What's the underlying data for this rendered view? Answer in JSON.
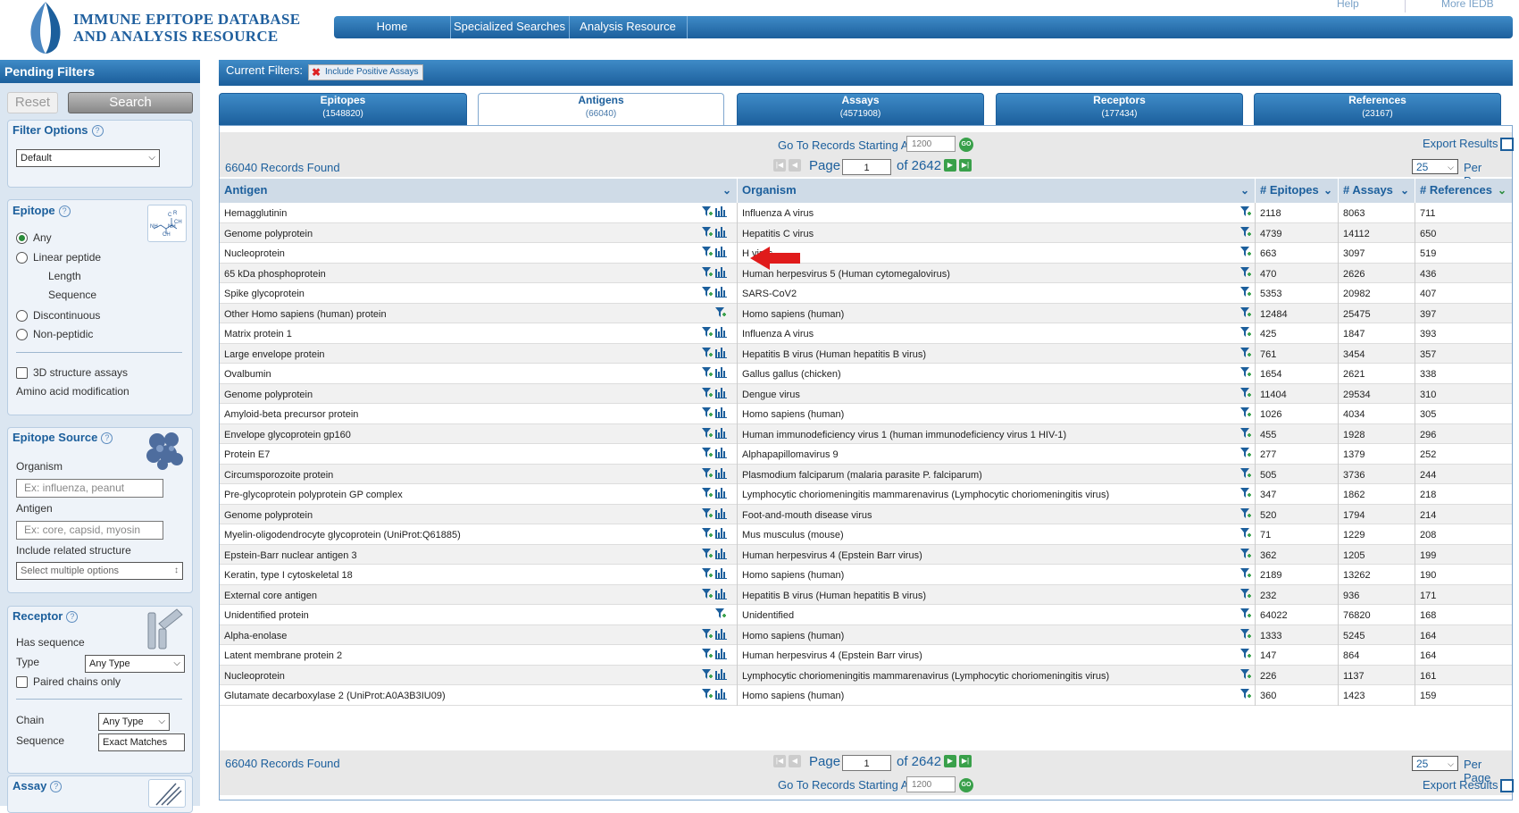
{
  "header": {
    "logo_line1": "IMMUNE EPITOPE DATABASE",
    "logo_line2": "AND ANALYSIS RESOURCE",
    "help": "Help",
    "more": "More IEDB",
    "nav": [
      "Home",
      "Specialized Searches",
      "Analysis Resource"
    ]
  },
  "left_panel": {
    "title": "Pending Filters",
    "reset": "Reset",
    "search": "Search",
    "filter_options": {
      "title": "Filter Options",
      "select": "Default"
    },
    "epitope": {
      "title": "Epitope",
      "any": "Any",
      "linear": "Linear peptide",
      "length": "Length",
      "sequence": "Sequence",
      "discontinuous": "Discontinuous",
      "non_peptidic": "Non-peptidic",
      "structure": "3D structure assays",
      "amino": "Amino acid modification"
    },
    "epitope_source": {
      "title": "Epitope Source",
      "organism": "Organism",
      "organism_ph": "Ex: influenza, peanut",
      "antigen": "Antigen",
      "antigen_ph": "Ex: core, capsid, myosin",
      "related": "Include related structure",
      "related_select": "Select multiple options"
    },
    "receptor": {
      "title": "Receptor",
      "has_sequence": "Has sequence",
      "type": "Type",
      "type_value": "Any Type",
      "paired": "Paired chains only",
      "chain": "Chain",
      "chain_value": "Any Type",
      "sequence": "Sequence",
      "sequence_value": "Exact Matches"
    },
    "assay": {
      "title": "Assay"
    }
  },
  "current_filters": {
    "label": "Current Filters:",
    "chip": "Include Positive Assays"
  },
  "tabs": [
    {
      "name": "Epitopes",
      "count": "(1548820)"
    },
    {
      "name": "Antigens",
      "count": "(66040)"
    },
    {
      "name": "Assays",
      "count": "(4571908)"
    },
    {
      "name": "Receptors",
      "count": "(177434)"
    },
    {
      "name": "References",
      "count": "(23167)"
    }
  ],
  "controls": {
    "goto": "Go To Records Starting At",
    "goto_value": "1200",
    "go": "GO",
    "export": "Export Results",
    "found": "66040 Records Found",
    "page": "Page",
    "page_value": "1",
    "of": "of 2642",
    "per_page_value": "25",
    "per_page": "Per Page"
  },
  "table": {
    "headers": [
      "Antigen",
      "Organism",
      "# Epitopes",
      "# Assays",
      "# References"
    ],
    "rows": [
      {
        "antigen": "Hemagglutinin",
        "organism": "Influenza A virus",
        "epitopes": "2118",
        "assays": "8063",
        "refs": "711",
        "chart": true
      },
      {
        "antigen": "Genome polyprotein",
        "organism": "Hepatitis C virus",
        "epitopes": "4739",
        "assays": "14112",
        "refs": "650",
        "chart": true
      },
      {
        "antigen": "Nucleoprotein",
        "organism": "H          virus",
        "epitopes": "663",
        "assays": "3097",
        "refs": "519",
        "chart": true
      },
      {
        "antigen": "65 kDa phosphoprotein",
        "organism": "Human herpesvirus 5 (Human cytomegalovirus)",
        "epitopes": "470",
        "assays": "2626",
        "refs": "436",
        "chart": true
      },
      {
        "antigen": "Spike glycoprotein",
        "organism": "SARS-CoV2",
        "epitopes": "5353",
        "assays": "20982",
        "refs": "407",
        "chart": true
      },
      {
        "antigen": "Other Homo sapiens (human) protein",
        "organism": "Homo sapiens (human)",
        "epitopes": "12484",
        "assays": "25475",
        "refs": "397",
        "chart": false
      },
      {
        "antigen": "Matrix protein 1",
        "organism": "Influenza A virus",
        "epitopes": "425",
        "assays": "1847",
        "refs": "393",
        "chart": true
      },
      {
        "antigen": "Large envelope protein",
        "organism": "Hepatitis B virus (Human hepatitis B virus)",
        "epitopes": "761",
        "assays": "3454",
        "refs": "357",
        "chart": true
      },
      {
        "antigen": "Ovalbumin",
        "organism": "Gallus gallus (chicken)",
        "epitopes": "1654",
        "assays": "2621",
        "refs": "338",
        "chart": true
      },
      {
        "antigen": "Genome polyprotein",
        "organism": "Dengue virus",
        "epitopes": "11404",
        "assays": "29534",
        "refs": "310",
        "chart": true
      },
      {
        "antigen": "Amyloid-beta precursor protein",
        "organism": "Homo sapiens (human)",
        "epitopes": "1026",
        "assays": "4034",
        "refs": "305",
        "chart": true
      },
      {
        "antigen": "Envelope glycoprotein gp160",
        "organism": "Human immunodeficiency virus 1 (human immunodeficiency virus 1 HIV-1)",
        "epitopes": "455",
        "assays": "1928",
        "refs": "296",
        "chart": true
      },
      {
        "antigen": "Protein E7",
        "organism": "Alphapapillomavirus 9",
        "epitopes": "277",
        "assays": "1379",
        "refs": "252",
        "chart": true
      },
      {
        "antigen": "Circumsporozoite protein",
        "organism": "Plasmodium falciparum (malaria parasite P. falciparum)",
        "epitopes": "505",
        "assays": "3736",
        "refs": "244",
        "chart": true
      },
      {
        "antigen": "Pre-glycoprotein polyprotein GP complex",
        "organism": "Lymphocytic choriomeningitis mammarenavirus (Lymphocytic choriomeningitis virus)",
        "epitopes": "347",
        "assays": "1862",
        "refs": "218",
        "chart": true
      },
      {
        "antigen": "Genome polyprotein",
        "organism": "Foot-and-mouth disease virus",
        "epitopes": "520",
        "assays": "1794",
        "refs": "214",
        "chart": true
      },
      {
        "antigen": "Myelin-oligodendrocyte glycoprotein (UniProt:Q61885)",
        "organism": "Mus musculus (mouse)",
        "epitopes": "71",
        "assays": "1229",
        "refs": "208",
        "chart": true
      },
      {
        "antigen": "Epstein-Barr nuclear antigen 3",
        "organism": "Human herpesvirus 4 (Epstein Barr virus)",
        "epitopes": "362",
        "assays": "1205",
        "refs": "199",
        "chart": true
      },
      {
        "antigen": "Keratin, type I cytoskeletal 18",
        "organism": "Homo sapiens (human)",
        "epitopes": "2189",
        "assays": "13262",
        "refs": "190",
        "chart": true
      },
      {
        "antigen": "External core antigen",
        "organism": "Hepatitis B virus (Human hepatitis B virus)",
        "epitopes": "232",
        "assays": "936",
        "refs": "171",
        "chart": true
      },
      {
        "antigen": "Unidentified protein",
        "organism": "Unidentified",
        "epitopes": "64022",
        "assays": "76820",
        "refs": "168",
        "chart": false
      },
      {
        "antigen": "Alpha-enolase",
        "organism": "Homo sapiens (human)",
        "epitopes": "1333",
        "assays": "5245",
        "refs": "164",
        "chart": true
      },
      {
        "antigen": "Latent membrane protein 2",
        "organism": "Human herpesvirus 4 (Epstein Barr virus)",
        "epitopes": "147",
        "assays": "864",
        "refs": "164",
        "chart": true
      },
      {
        "antigen": "Nucleoprotein",
        "organism": "Lymphocytic choriomeningitis mammarenavirus (Lymphocytic choriomeningitis virus)",
        "epitopes": "226",
        "assays": "1137",
        "refs": "161",
        "chart": true
      },
      {
        "antigen": "Glutamate decarboxylase 2 (UniProt:A0A3B3IU09)",
        "organism": "Homo sapiens (human)",
        "epitopes": "360",
        "assays": "1423",
        "refs": "159",
        "chart": true
      }
    ]
  },
  "colors": {
    "brand_blue": "#1c5f9c",
    "go_green": "#39a04a",
    "annotation_red": "#e01b1b"
  }
}
